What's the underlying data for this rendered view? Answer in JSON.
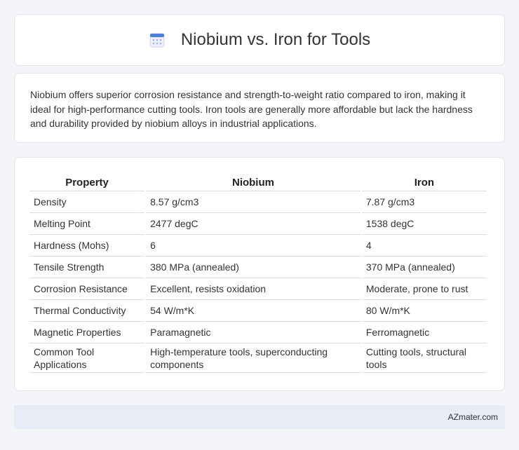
{
  "header": {
    "title": "Niobium vs. Iron for Tools",
    "icon": "calendar-icon",
    "accent": "#4a7fe0"
  },
  "intro": {
    "text": "Niobium offers superior corrosion resistance and strength-to-weight ratio compared to iron, making it ideal for high-performance cutting tools. Iron tools are generally more affordable but lack the hardness and durability provided by niobium alloys in industrial applications."
  },
  "table": {
    "headers": [
      "Property",
      "Niobium",
      "Iron"
    ],
    "rows": [
      [
        "Density",
        "8.57 g/cm3",
        "7.87 g/cm3"
      ],
      [
        "Melting Point",
        "2477 degC",
        "1538 degC"
      ],
      [
        "Hardness (Mohs)",
        "6",
        "4"
      ],
      [
        "Tensile Strength",
        "380 MPa (annealed)",
        "370 MPa (annealed)"
      ],
      [
        "Corrosion Resistance",
        "Excellent, resists oxidation",
        "Moderate, prone to rust"
      ],
      [
        "Thermal Conductivity",
        "54 W/m*K",
        "80 W/m*K"
      ],
      [
        "Magnetic Properties",
        "Paramagnetic",
        "Ferromagnetic"
      ],
      [
        "Common Tool Applications",
        "High-temperature tools, superconducting components",
        "Cutting tools, structural tools"
      ]
    ]
  },
  "footer": {
    "site": "AZmater.com"
  }
}
